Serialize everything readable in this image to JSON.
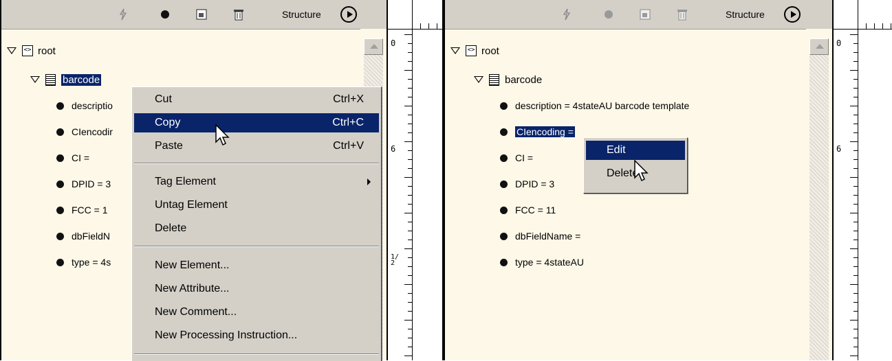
{
  "left": {
    "toolbar": {
      "structure_label": "Structure"
    },
    "tree": {
      "root": "root",
      "barcode": "barcode",
      "attrs": [
        "descriptio",
        "CIencodir",
        "CI =",
        "DPID = 3",
        "FCC = 1",
        "dbFieldN",
        "type = 4s"
      ]
    },
    "context_menu": {
      "items": [
        {
          "label": "Cut",
          "shortcut": "Ctrl+X"
        },
        {
          "label": "Copy",
          "shortcut": "Ctrl+C"
        },
        {
          "label": "Paste",
          "shortcut": "Ctrl+V"
        },
        {
          "label": "Tag Element"
        },
        {
          "label": "Untag Element"
        },
        {
          "label": "Delete"
        },
        {
          "label": "New Element..."
        },
        {
          "label": "New Attribute..."
        },
        {
          "label": "New Comment..."
        },
        {
          "label": "New Processing Instruction..."
        }
      ]
    }
  },
  "right": {
    "toolbar": {
      "structure_label": "Structure"
    },
    "tree": {
      "root": "root",
      "barcode": "barcode",
      "attrs": [
        "description = 4stateAU barcode template",
        "CIencoding =",
        "CI =",
        "DPID = 3",
        "FCC = 11",
        "dbFieldName =",
        "type = 4stateAU"
      ]
    },
    "context_menu": {
      "items": [
        {
          "label": "Edit"
        },
        {
          "label": "Delete"
        }
      ]
    }
  },
  "ruler": {
    "marks": [
      "0",
      "6",
      "1/2"
    ]
  },
  "colors": {
    "selection": "#0a246a",
    "panel_bg": "#fdf8e8",
    "chrome": "#d4d0c8"
  }
}
